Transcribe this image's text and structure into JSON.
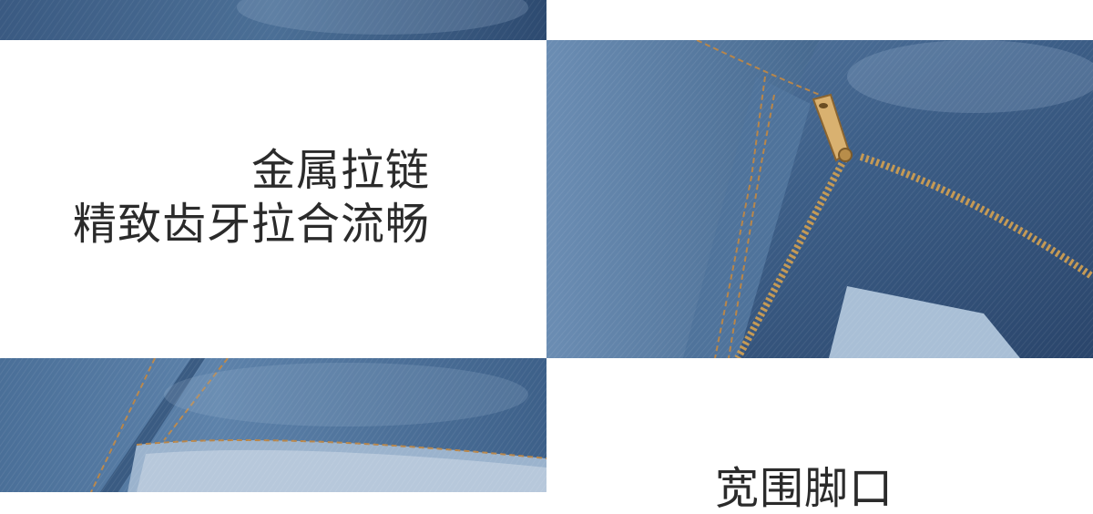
{
  "features": [
    {
      "title": "金属拉链",
      "description": "精致齿牙拉合流畅"
    },
    {
      "title": "宽围脚口"
    }
  ],
  "colors": {
    "background": "#ffffff",
    "text": "#2b2b2b",
    "denim_dark": "#2f4c73",
    "denim_mid": "#4a6f98",
    "denim_light": "#8fa9c6",
    "stitching": "#b8864a",
    "zipper": "#c59a55"
  },
  "photos": [
    {
      "name": "denim-fabric-top-photo"
    },
    {
      "name": "metal-zipper-photo"
    },
    {
      "name": "denim-hem-photo"
    }
  ]
}
